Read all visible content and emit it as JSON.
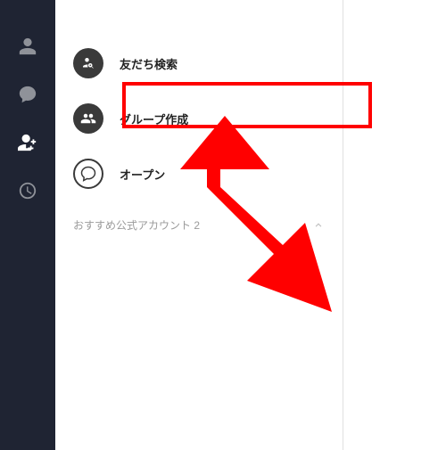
{
  "sidebar": {
    "items": [
      {
        "name": "friends",
        "active": false
      },
      {
        "name": "chat",
        "active": false
      },
      {
        "name": "add-friend",
        "active": true
      },
      {
        "name": "recent",
        "active": false
      }
    ]
  },
  "menu": {
    "friend_search_label": "友だち検索",
    "group_create_label": "グループ作成",
    "openchat_label": "オープン"
  },
  "section": {
    "recommended_label": "おすすめ公式アカウント 2"
  },
  "colors": {
    "sidebar_bg": "#1f2433",
    "highlight": "#ff0000",
    "arrow": "#ff0000"
  }
}
